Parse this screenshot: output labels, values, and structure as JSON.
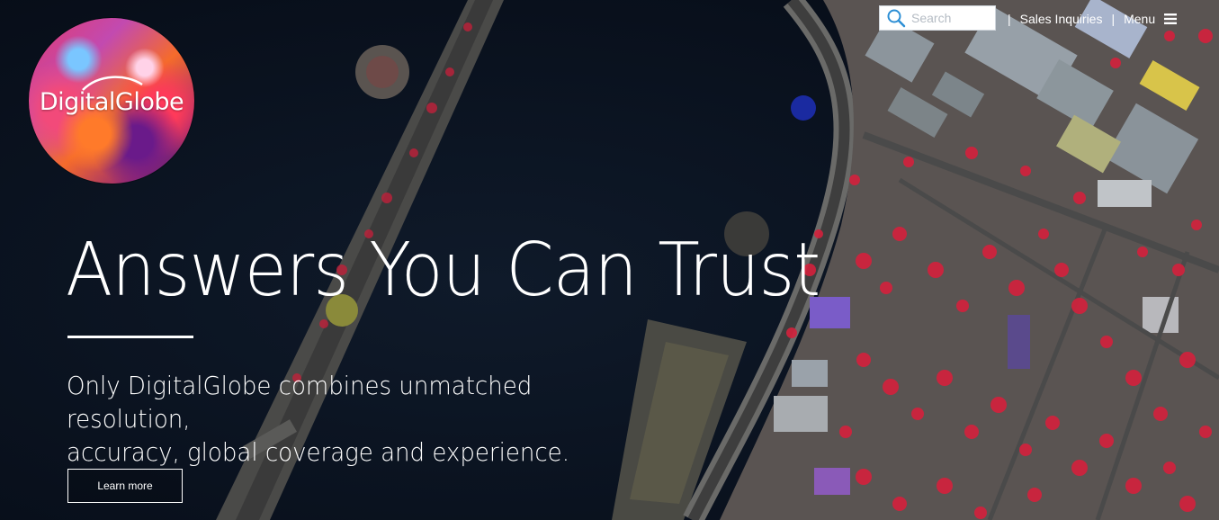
{
  "brand": {
    "logo_text": "DigitalGlobe"
  },
  "header": {
    "search_placeholder": "Search",
    "sales_label": "Sales Inquiries",
    "menu_label": "Menu",
    "separator": "|"
  },
  "hero": {
    "headline": "Answers You Can Trust",
    "subhead_line1": "Only DigitalGlobe combines unmatched resolution,",
    "subhead_line2": "accuracy, global coverage and experience.",
    "cta_label": "Learn more"
  },
  "colors": {
    "text": "#ffffff",
    "water": "#0a1320",
    "vegetation_red": "#d4213c"
  },
  "icons": [
    "search-icon",
    "menu-icon"
  ]
}
